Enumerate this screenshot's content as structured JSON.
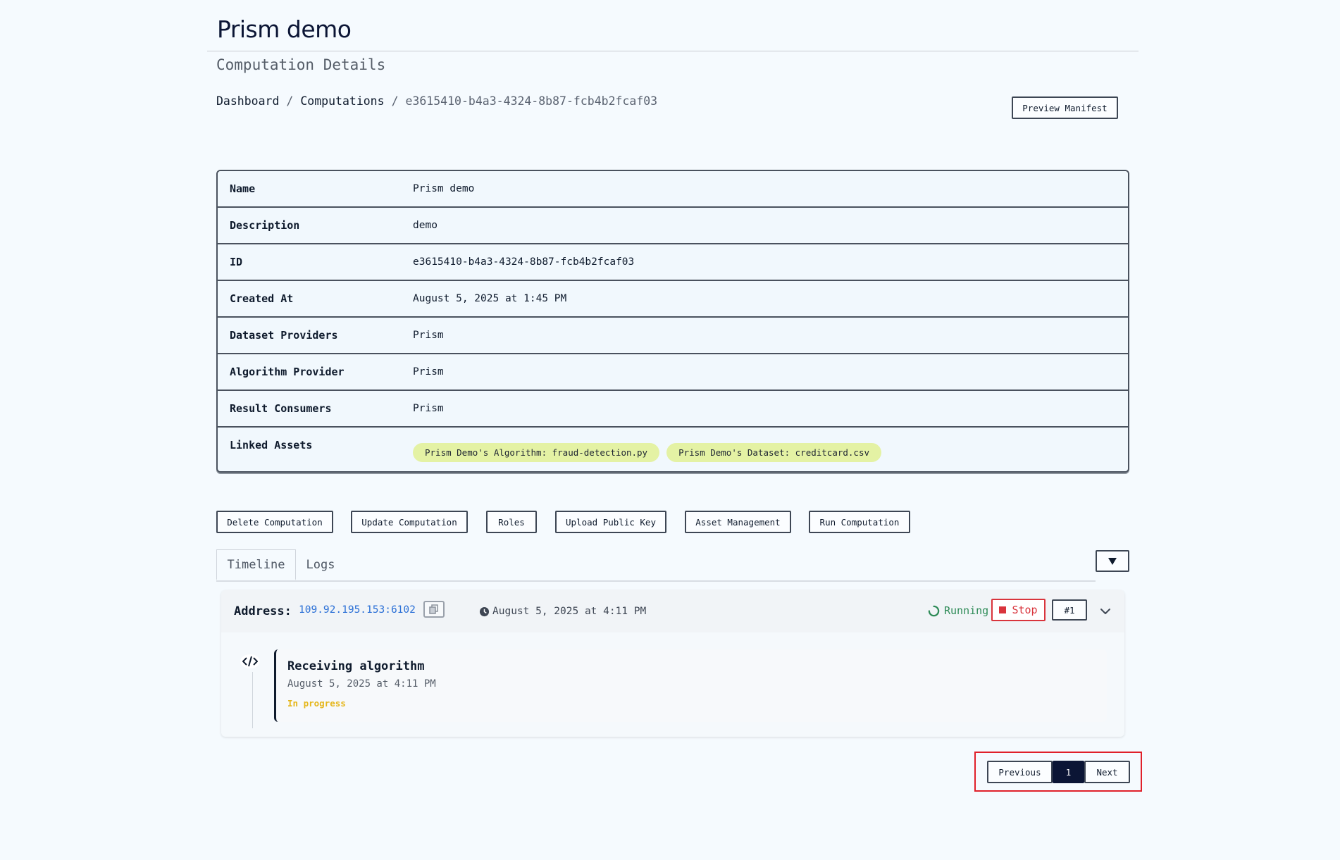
{
  "app": {
    "title": "Prism demo"
  },
  "page": {
    "section_title": "Computation Details"
  },
  "breadcrumb": {
    "dashboard": "Dashboard",
    "computations": "Computations",
    "current": "e3615410-b4a3-4324-8b87-fcb4b2fcaf03",
    "separator": "/"
  },
  "header_actions": {
    "preview_manifest": "Preview Manifest"
  },
  "details": {
    "rows": [
      {
        "label": "Name",
        "value": "Prism demo"
      },
      {
        "label": "Description",
        "value": "demo"
      },
      {
        "label": "ID",
        "value": "e3615410-b4a3-4324-8b87-fcb4b2fcaf03"
      },
      {
        "label": "Created At",
        "value": "August 5, 2025 at 1:45 PM"
      },
      {
        "label": "Dataset Providers",
        "value": "Prism"
      },
      {
        "label": "Algorithm Provider",
        "value": "Prism"
      },
      {
        "label": "Result Consumers",
        "value": "Prism"
      }
    ],
    "linked_assets_label": "Linked Assets",
    "linked_assets": [
      "Prism Demo's Algorithm: fraud-detection.py",
      "Prism Demo's Dataset: creditcard.csv"
    ]
  },
  "actions": {
    "delete": "Delete Computation",
    "update": "Update Computation",
    "roles": "Roles",
    "upload_key": "Upload Public Key",
    "asset_management": "Asset Management",
    "run": "Run Computation"
  },
  "tabs": {
    "timeline": "Timeline",
    "logs": "Logs"
  },
  "run": {
    "address_label": "Address:",
    "address": "109.92.195.153:6102",
    "time": "August 5, 2025 at 4:11 PM",
    "status": "Running",
    "stop": "Stop",
    "number": "#1"
  },
  "event": {
    "title": "Receiving algorithm",
    "time": "August 5, 2025 at 4:11 PM",
    "status": "In progress"
  },
  "pagination": {
    "previous": "Previous",
    "page": "1",
    "next": "Next"
  },
  "colors": {
    "accent_dark": "#0b1535",
    "chip": "#e4f2a4",
    "running": "#2e8b57",
    "stop": "#d9343c",
    "in_progress": "#e5b61a",
    "link": "#2a6fd6"
  }
}
